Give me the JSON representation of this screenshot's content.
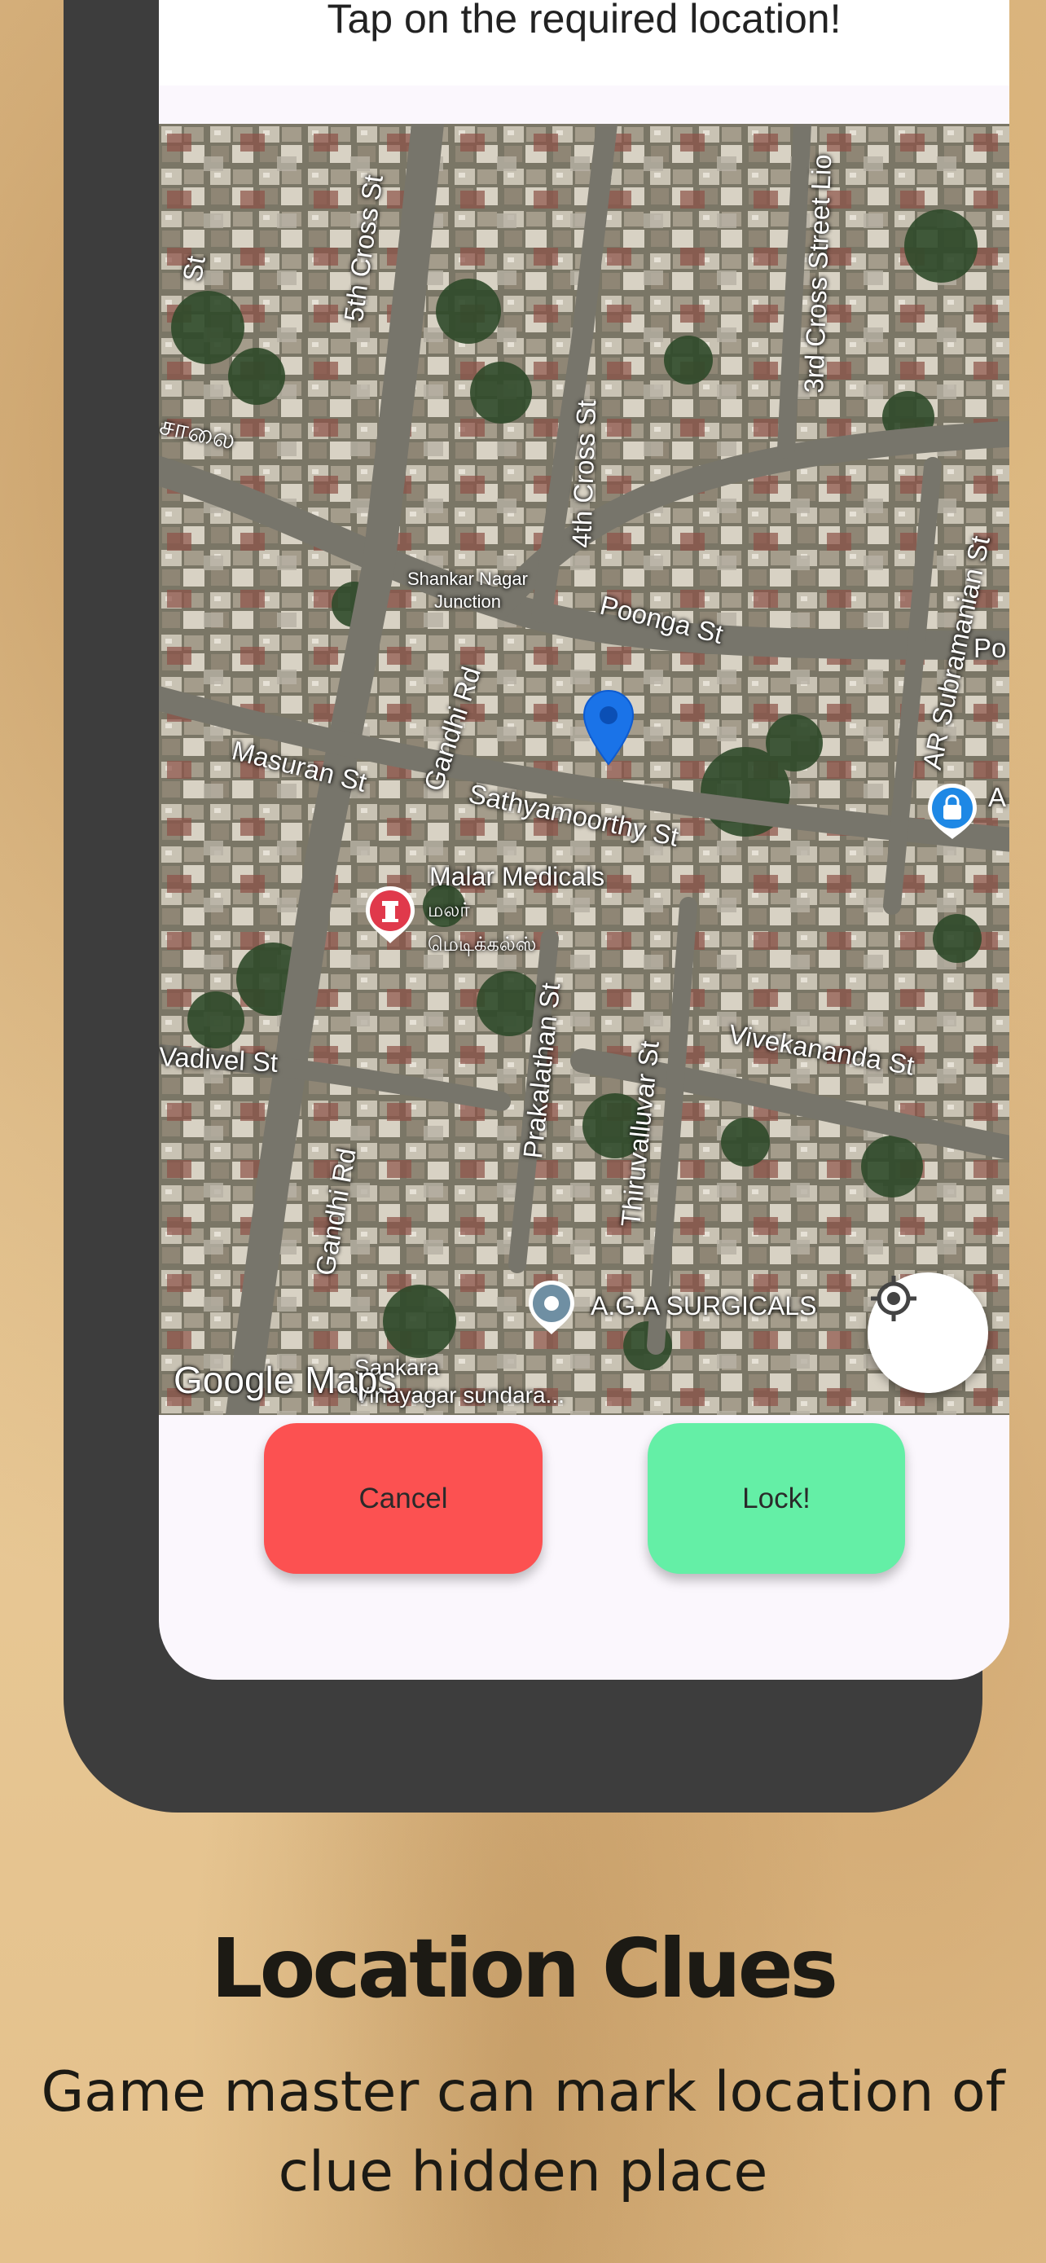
{
  "prompt": {
    "title": "Tap on the required location!"
  },
  "map": {
    "streets": {
      "fifth_cross": "5th Cross St",
      "fourth_cross": "4th Cross St",
      "third_cross": "3rd Cross Street Lio",
      "salai": "சாலை",
      "junction": "Shankar Nagar\nJunction",
      "poonga": "Poonga St",
      "ar_subramanian": "AR Subramanian St",
      "gandhi_top": "Gandhi Rd",
      "masuran": "Masuran St",
      "sathyamoorthy": "Sathyamoorthy St",
      "vadivel": "Vadivel St",
      "prakalathan": "Prakalathan St",
      "thiruvalluvar": "Thiruvalluvar St",
      "vivekananda": "Vivekananda St",
      "gandhi_bottom": "Gandhi Rd",
      "edge_st": "St",
      "edge_po": "Po",
      "edge_a": "A",
      "sankara": "Sankara\nVinayagar sundara..."
    },
    "poi": {
      "malar": "Malar Medicals",
      "malar_tamil_1": "மலர்",
      "malar_tamil_2": "மெடிக்கல்ஸ்",
      "aga": "A.G.A SURGICALS"
    },
    "attribution": "Google Maps",
    "icons": {
      "pin": "location-pin-icon",
      "locate": "my-location-icon",
      "pharmacy": "pharmacy-icon",
      "shop": "shopping-bag-icon",
      "place": "place-icon"
    }
  },
  "buttons": {
    "cancel": "Cancel",
    "lock": "Lock!"
  },
  "promo": {
    "headline": "Location Clues",
    "subline": "Game master can mark location of clue hidden place"
  },
  "colors": {
    "cancel": "#fc5151",
    "lock": "#64efa6",
    "pin": "#1a73e8",
    "phone_frame": "#3d3d3d"
  }
}
